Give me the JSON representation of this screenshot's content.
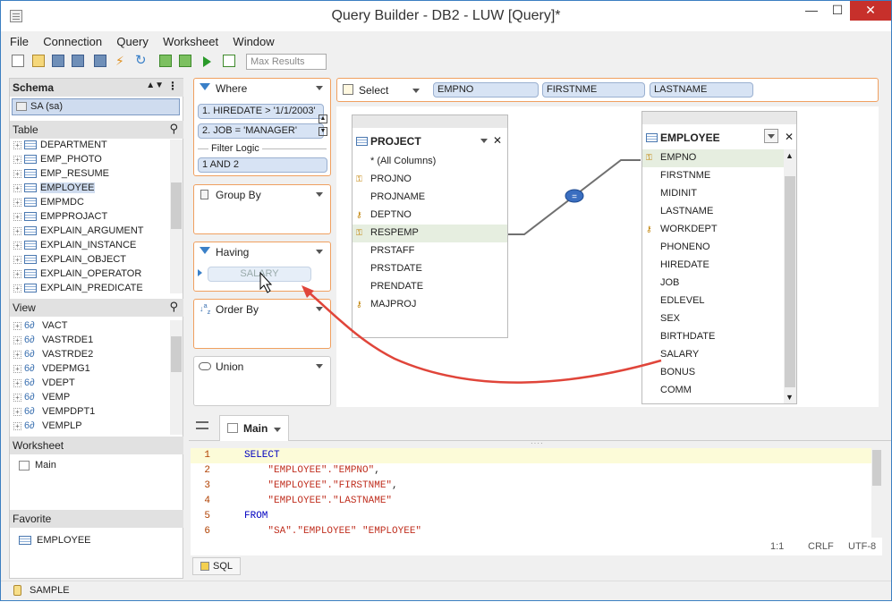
{
  "window": {
    "title": "Query Builder - DB2 - LUW [Query]*",
    "min": "—",
    "max": "☐",
    "close": "✕"
  },
  "menu": [
    "File",
    "Connection",
    "Query",
    "Worksheet",
    "Window"
  ],
  "toolbar": {
    "max_results_placeholder": "Max Results"
  },
  "schema": {
    "header": "Schema",
    "selected": "SA (sa)"
  },
  "tables": {
    "header": "Table",
    "items": [
      "DEPARTMENT",
      "EMP_PHOTO",
      "EMP_RESUME",
      "EMPLOYEE",
      "EMPMDC",
      "EMPPROJACT",
      "EXPLAIN_ARGUMENT",
      "EXPLAIN_INSTANCE",
      "EXPLAIN_OBJECT",
      "EXPLAIN_OPERATOR",
      "EXPLAIN_PREDICATE"
    ]
  },
  "views": {
    "header": "View",
    "items": [
      "VACT",
      "VASTRDE1",
      "VASTRDE2",
      "VDEPMG1",
      "VDEPT",
      "VEMP",
      "VEMPDPT1",
      "VEMPLP"
    ]
  },
  "worksheet": {
    "header": "Worksheet",
    "item": "Main"
  },
  "favorite": {
    "header": "Favorite",
    "item": "EMPLOYEE"
  },
  "where": {
    "label": "Where",
    "cond1": "1. HIREDATE > '1/1/2003'",
    "cond2": "2. JOB = 'MANAGER'",
    "filter_logic": "Filter Logic",
    "logic": "1 AND 2"
  },
  "group_by": {
    "label": "Group By"
  },
  "having": {
    "label": "Having",
    "drag_item": "SALARY"
  },
  "order_by": {
    "label": "Order By"
  },
  "union": {
    "label": "Union"
  },
  "select": {
    "label": "Select",
    "columns": [
      "EMPNO",
      "FIRSTNME",
      "LASTNAME"
    ]
  },
  "project_table": {
    "name": "PROJECT",
    "columns": [
      "* (All Columns)",
      "PROJNO",
      "PROJNAME",
      "DEPTNO",
      "RESPEMP",
      "PRSTAFF",
      "PRSTDATE",
      "PRENDATE",
      "MAJPROJ"
    ]
  },
  "employee_table": {
    "name": "EMPLOYEE",
    "columns": [
      "EMPNO",
      "FIRSTNME",
      "MIDINIT",
      "LASTNAME",
      "WORKDEPT",
      "PHONENO",
      "HIREDATE",
      "JOB",
      "EDLEVEL",
      "SEX",
      "BIRTHDATE",
      "SALARY",
      "BONUS",
      "COMM"
    ]
  },
  "editor": {
    "tab": "Main",
    "sql_tab": "SQL",
    "position": "1:1",
    "line_ending": "CRLF",
    "encoding": "UTF-8",
    "lines": [
      {
        "n": "1",
        "parts": [
          [
            "kw",
            "SELECT"
          ]
        ]
      },
      {
        "n": "2",
        "parts": [
          [
            "",
            "    "
          ],
          [
            "str",
            "\"EMPLOYEE\".\"EMPNO\""
          ],
          [
            "",
            ","
          ]
        ]
      },
      {
        "n": "3",
        "parts": [
          [
            "",
            "    "
          ],
          [
            "str",
            "\"EMPLOYEE\".\"FIRSTNME\""
          ],
          [
            "",
            ","
          ]
        ]
      },
      {
        "n": "4",
        "parts": [
          [
            "",
            "    "
          ],
          [
            "str",
            "\"EMPLOYEE\".\"LASTNAME\""
          ]
        ]
      },
      {
        "n": "5",
        "parts": [
          [
            "kw",
            "FROM"
          ]
        ]
      },
      {
        "n": "6",
        "parts": [
          [
            "",
            "    "
          ],
          [
            "str",
            "\"SA\".\"EMPLOYEE\" \"EMPLOYEE\""
          ]
        ]
      }
    ]
  },
  "status": {
    "connection": "SAMPLE"
  },
  "colors": {
    "accent_border": "#f0a060",
    "chip_bg": "#d7e3f4",
    "close_red": "#c7302b",
    "highlight_row": "#e6eee0"
  }
}
